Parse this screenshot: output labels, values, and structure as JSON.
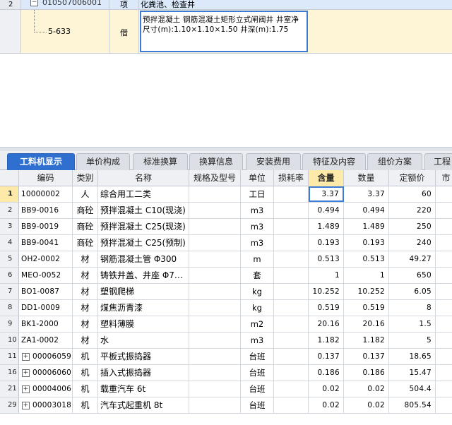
{
  "top_grid": {
    "rows": [
      {
        "num": "2",
        "expander": "−",
        "code": "010507006001",
        "type": "项",
        "name": "化粪池、检查井"
      },
      {
        "num": "",
        "code": "5-633",
        "type": "借",
        "name": "预拌混凝土 钢筋混凝土矩形立式闸阀井 井室净尺寸(m):1.10×1.10×1.50 井深(m):1.75"
      }
    ]
  },
  "tabs": [
    {
      "label": "工料机显示",
      "active": true
    },
    {
      "label": "单价构成",
      "active": false
    },
    {
      "label": "标准换算",
      "active": false
    },
    {
      "label": "换算信息",
      "active": false
    },
    {
      "label": "安装费用",
      "active": false
    },
    {
      "label": "特征及内容",
      "active": false
    },
    {
      "label": "组价方案",
      "active": false
    },
    {
      "label": "工程",
      "active": false
    }
  ],
  "grid": {
    "columns": [
      "",
      "编码",
      "类别",
      "名称",
      "规格及型号",
      "单位",
      "损耗率",
      "含量",
      "数量",
      "定额价",
      "市"
    ],
    "rows": [
      {
        "num": "1",
        "code": "10000002",
        "cat": "人",
        "name": "综合用工二类",
        "spec": "",
        "unit": "工日",
        "loss": "",
        "content": "3.37",
        "qty": "3.37",
        "price": "60",
        "expand": false
      },
      {
        "num": "2",
        "code": "BB9-0016",
        "cat": "商砼",
        "name": "预拌混凝土 C10(现浇)",
        "spec": "",
        "unit": "m3",
        "loss": "",
        "content": "0.494",
        "qty": "0.494",
        "price": "220",
        "expand": false
      },
      {
        "num": "3",
        "code": "BB9-0019",
        "cat": "商砼",
        "name": "预拌混凝土 C25(现浇)",
        "spec": "",
        "unit": "m3",
        "loss": "",
        "content": "1.489",
        "qty": "1.489",
        "price": "250",
        "expand": false
      },
      {
        "num": "4",
        "code": "BB9-0041",
        "cat": "商砼",
        "name": "预拌混凝土 C25(预制)",
        "spec": "",
        "unit": "m3",
        "loss": "",
        "content": "0.193",
        "qty": "0.193",
        "price": "240",
        "expand": false
      },
      {
        "num": "5",
        "code": "OH2-0002",
        "cat": "材",
        "name": "钢筋混凝土管 Φ300",
        "spec": "",
        "unit": "m",
        "loss": "",
        "content": "0.513",
        "qty": "0.513",
        "price": "49.27",
        "expand": false
      },
      {
        "num": "6",
        "code": "MEO-0052",
        "cat": "材",
        "name": "铸铁井盖、井座 Φ7…",
        "spec": "",
        "unit": "套",
        "loss": "",
        "content": "1",
        "qty": "1",
        "price": "650",
        "expand": false
      },
      {
        "num": "7",
        "code": "BO1-0087",
        "cat": "材",
        "name": "塑钢爬梯",
        "spec": "",
        "unit": "kg",
        "loss": "",
        "content": "10.252",
        "qty": "10.252",
        "price": "6.05",
        "expand": false
      },
      {
        "num": "8",
        "code": "DD1-0009",
        "cat": "材",
        "name": "煤焦沥青漆",
        "spec": "",
        "unit": "kg",
        "loss": "",
        "content": "0.519",
        "qty": "0.519",
        "price": "8",
        "expand": false
      },
      {
        "num": "9",
        "code": "BK1-2000",
        "cat": "材",
        "name": "塑料薄膜",
        "spec": "",
        "unit": "m2",
        "loss": "",
        "content": "20.16",
        "qty": "20.16",
        "price": "1.5",
        "expand": false
      },
      {
        "num": "10",
        "code": "ZA1-0002",
        "cat": "材",
        "name": "水",
        "spec": "",
        "unit": "m3",
        "loss": "",
        "content": "1.182",
        "qty": "1.182",
        "price": "5",
        "expand": false
      },
      {
        "num": "11",
        "code": "00006059",
        "cat": "机",
        "name": "平板式振捣器",
        "spec": "",
        "unit": "台班",
        "loss": "",
        "content": "0.137",
        "qty": "0.137",
        "price": "18.65",
        "expand": true
      },
      {
        "num": "16",
        "code": "00006060",
        "cat": "机",
        "name": "插入式振捣器",
        "spec": "",
        "unit": "台班",
        "loss": "",
        "content": "0.186",
        "qty": "0.186",
        "price": "15.47",
        "expand": true
      },
      {
        "num": "21",
        "code": "00004006",
        "cat": "机",
        "name": "载重汽车 6t",
        "spec": "",
        "unit": "台班",
        "loss": "",
        "content": "0.02",
        "qty": "0.02",
        "price": "504.4",
        "expand": true
      },
      {
        "num": "29",
        "code": "00003018",
        "cat": "机",
        "name": "汽车式起重机 8t",
        "spec": "",
        "unit": "台班",
        "loss": "",
        "content": "0.02",
        "qty": "0.02",
        "price": "805.54",
        "expand": true
      }
    ]
  },
  "colors": {
    "tab_active": "#2f6fcf",
    "highlight": "#fde9a8",
    "selected_row": "#fdf5d6",
    "focus_border": "#3b7bd6"
  }
}
